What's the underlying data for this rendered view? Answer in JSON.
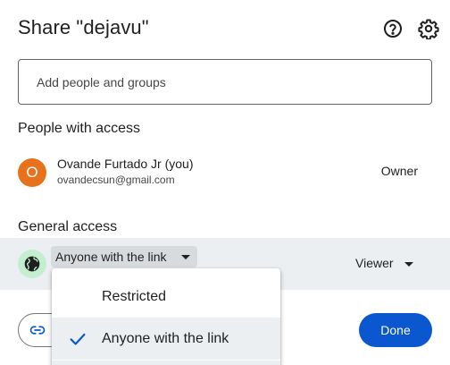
{
  "dialog": {
    "title": "Share \"dejavu\"",
    "icons": {
      "help": "help-circle-icon",
      "settings": "gear-icon"
    }
  },
  "add_people": {
    "placeholder": "Add people and groups",
    "value": ""
  },
  "people_with_access": {
    "title": "People with access",
    "people": [
      {
        "avatar_letter": "O",
        "avatar_color": "#e8711c",
        "name": "Ovande Furtado Jr (you)",
        "email": "ovandecsun@gmail.com",
        "role": "Owner"
      }
    ]
  },
  "general_access": {
    "title": "General access",
    "icon": "globe-icon",
    "selected": "Anyone with the link",
    "role": "Viewer",
    "menu": {
      "items": [
        {
          "label": "Restricted",
          "selected": false
        },
        {
          "label": "Anyone with the link",
          "selected": true
        }
      ]
    }
  },
  "footer": {
    "copy_link_icon": "link-icon",
    "done_label": "Done"
  },
  "colors": {
    "accent": "#0b57d0",
    "row_highlight": "#eceff1",
    "globe_bg": "#c4eed0"
  }
}
